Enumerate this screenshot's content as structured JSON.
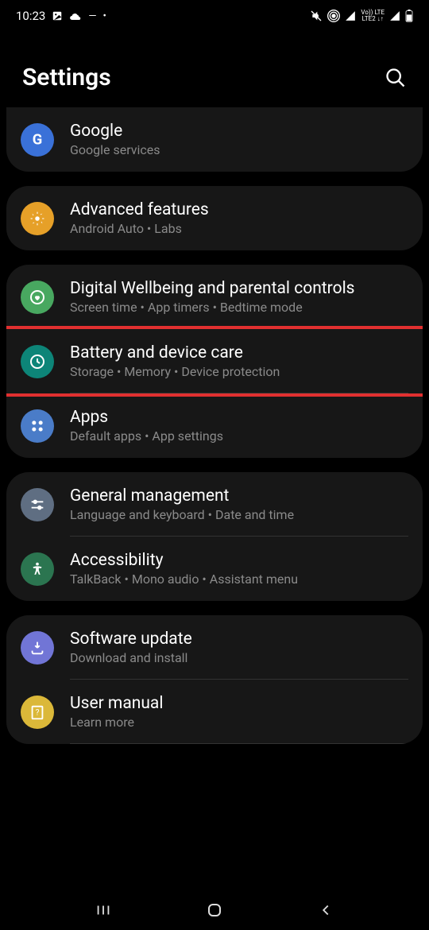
{
  "status": {
    "time": "10:23",
    "network_label": "Vo) LTE\nLTE2 ↓↑"
  },
  "header": {
    "title": "Settings"
  },
  "groups": [
    {
      "items": [
        {
          "id": "google",
          "title": "Google",
          "sub": "Google services"
        }
      ]
    },
    {
      "items": [
        {
          "id": "advanced",
          "title": "Advanced features",
          "sub": "Android Auto  •  Labs"
        }
      ]
    },
    {
      "items": [
        {
          "id": "wellbeing",
          "title": "Digital Wellbeing and parental controls",
          "sub": "Screen time  •  App timers  •  Bedtime mode"
        },
        {
          "id": "battery",
          "title": "Battery and device care",
          "sub": "Storage  •  Memory  •  Device protection"
        },
        {
          "id": "apps",
          "title": "Apps",
          "sub": "Default apps  •  App settings"
        }
      ]
    },
    {
      "items": [
        {
          "id": "general",
          "title": "General management",
          "sub": "Language and keyboard  •  Date and time"
        },
        {
          "id": "accessibility",
          "title": "Accessibility",
          "sub": "TalkBack  •  Mono audio  •  Assistant menu"
        }
      ]
    },
    {
      "items": [
        {
          "id": "software",
          "title": "Software update",
          "sub": "Download and install"
        },
        {
          "id": "manual",
          "title": "User manual",
          "sub": "Learn more"
        }
      ]
    }
  ]
}
